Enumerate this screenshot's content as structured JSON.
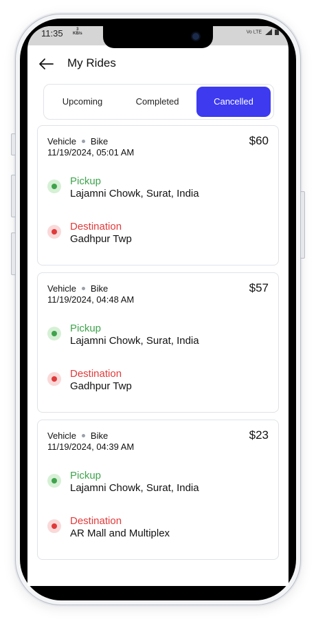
{
  "status_bar": {
    "time": "11:35",
    "speed_value": "3",
    "speed_unit": "KB/s",
    "network_label": "Vo LTE"
  },
  "header": {
    "title": "My Rides",
    "back_icon": "arrow-left-icon"
  },
  "tabs": [
    {
      "label": "Upcoming",
      "active": false
    },
    {
      "label": "Completed",
      "active": false
    },
    {
      "label": "Cancelled",
      "active": true
    }
  ],
  "accent_color": "#3d3af0",
  "pickup_color": "#3fa34d",
  "destination_color": "#e03a3a",
  "rides": [
    {
      "vehicle_label": "Vehicle",
      "vehicle_type": "Bike",
      "datetime": "11/19/2024,  05:01 AM",
      "price": "$60",
      "pickup_label": "Pickup",
      "pickup_address": "Lajamni Chowk, Surat, India",
      "destination_label": "Destination",
      "destination_address": "Gadhpur Twp"
    },
    {
      "vehicle_label": "Vehicle",
      "vehicle_type": "Bike",
      "datetime": "11/19/2024,  04:48 AM",
      "price": "$57",
      "pickup_label": "Pickup",
      "pickup_address": "Lajamni Chowk, Surat, India",
      "destination_label": "Destination",
      "destination_address": "Gadhpur Twp"
    },
    {
      "vehicle_label": "Vehicle",
      "vehicle_type": "Bike",
      "datetime": "11/19/2024,  04:39 AM",
      "price": "$23",
      "pickup_label": "Pickup",
      "pickup_address": "Lajamni Chowk, Surat, India",
      "destination_label": "Destination",
      "destination_address": "AR Mall and Multiplex"
    }
  ]
}
